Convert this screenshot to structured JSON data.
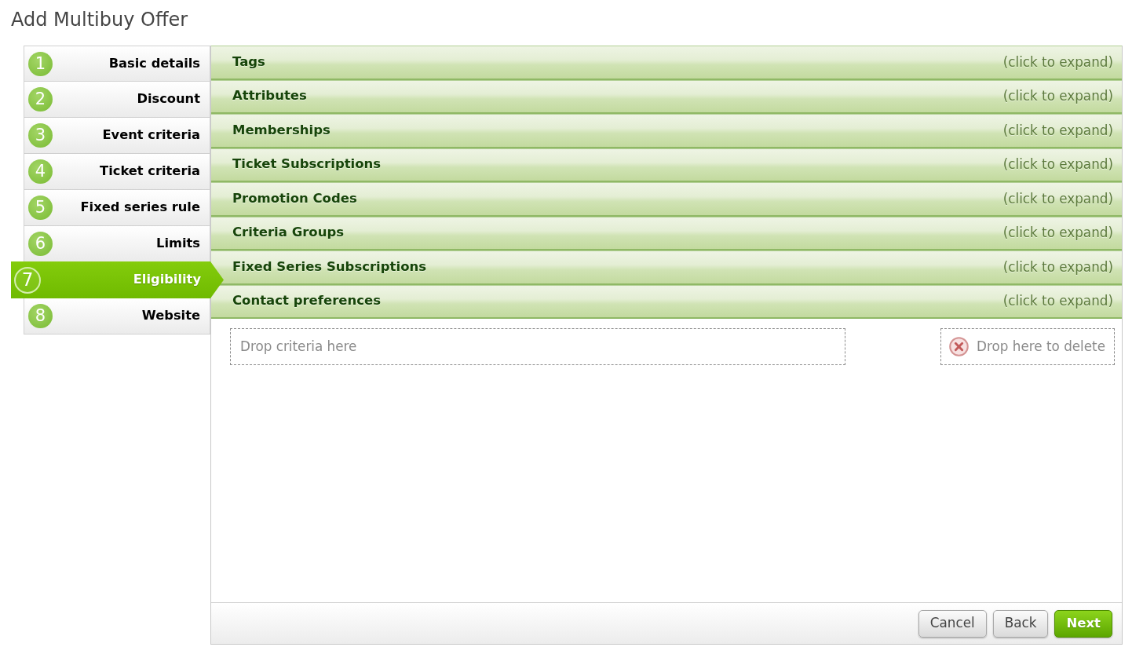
{
  "title": "Add Multibuy Offer",
  "steps": [
    {
      "number": "1",
      "label": "Basic details",
      "selected": false
    },
    {
      "number": "2",
      "label": "Discount",
      "selected": false
    },
    {
      "number": "3",
      "label": "Event criteria",
      "selected": false
    },
    {
      "number": "4",
      "label": "Ticket criteria",
      "selected": false
    },
    {
      "number": "5",
      "label": "Fixed series rule",
      "selected": false
    },
    {
      "number": "6",
      "label": "Limits",
      "selected": false
    },
    {
      "number": "7",
      "label": "Eligibility",
      "selected": true
    },
    {
      "number": "8",
      "label": "Website",
      "selected": false
    }
  ],
  "sections": [
    {
      "title": "Tags",
      "hint": "(click to expand)"
    },
    {
      "title": "Attributes",
      "hint": "(click to expand)"
    },
    {
      "title": "Memberships",
      "hint": "(click to expand)"
    },
    {
      "title": "Ticket Subscriptions",
      "hint": "(click to expand)"
    },
    {
      "title": "Promotion Codes",
      "hint": "(click to expand)"
    },
    {
      "title": "Criteria Groups",
      "hint": "(click to expand)"
    },
    {
      "title": "Fixed Series Subscriptions",
      "hint": "(click to expand)"
    },
    {
      "title": "Contact preferences",
      "hint": "(click to expand)"
    }
  ],
  "drop_zones": {
    "criteria": {
      "text": "Drop criteria here"
    },
    "delete": {
      "text": "Drop here to delete"
    }
  },
  "buttons": [
    {
      "label": "Cancel",
      "kind": "secondary"
    },
    {
      "label": "Back",
      "kind": "secondary"
    },
    {
      "label": "Next",
      "kind": "primary"
    }
  ]
}
